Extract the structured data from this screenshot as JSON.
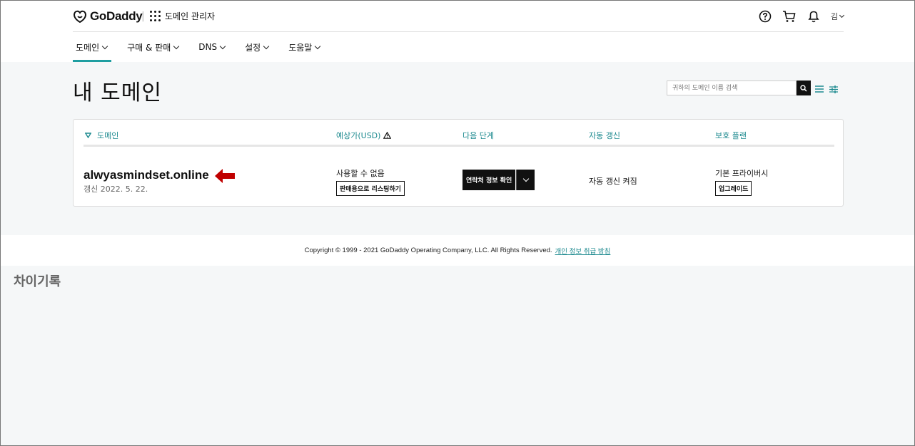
{
  "header": {
    "logo_text": "GoDaddy",
    "app_name": "도메인 관리자",
    "user_name": "김"
  },
  "nav": {
    "items": [
      {
        "label": "도메인",
        "active": true
      },
      {
        "label": "구매 & 판매",
        "active": false
      },
      {
        "label": "DNS",
        "active": false
      },
      {
        "label": "설정",
        "active": false
      },
      {
        "label": "도움말",
        "active": false
      }
    ]
  },
  "page": {
    "title": "내 도메인",
    "search_placeholder": "귀하의 도메인 이름 검색"
  },
  "table": {
    "columns": [
      "도메인",
      "예상가(USD)",
      "다음 단계",
      "자동 갱신",
      "보호 플랜"
    ],
    "rows": [
      {
        "domain": "alwyasmindset.online",
        "renew_date": "갱신 2022. 5. 22.",
        "price_status": "사용할 수 없음",
        "list_for_sale": "판매용으로 리스팅하기",
        "next_step": "연락처 정보 확인",
        "auto_renew": "자동 갱신 켜짐",
        "protection": "기본 프라이버시",
        "upgrade": "업그레이드"
      }
    ]
  },
  "footer": {
    "copyright": "Copyright © 1999 - 2021 GoDaddy Operating Company, LLC. All Rights Reserved.",
    "privacy_link": "개인 정보 취급 방침"
  },
  "annotation": {
    "history_label": "차이기록"
  },
  "colors": {
    "accent": "#1f9ea1",
    "arrow": "#c00000",
    "background": "#f5f7f8"
  }
}
